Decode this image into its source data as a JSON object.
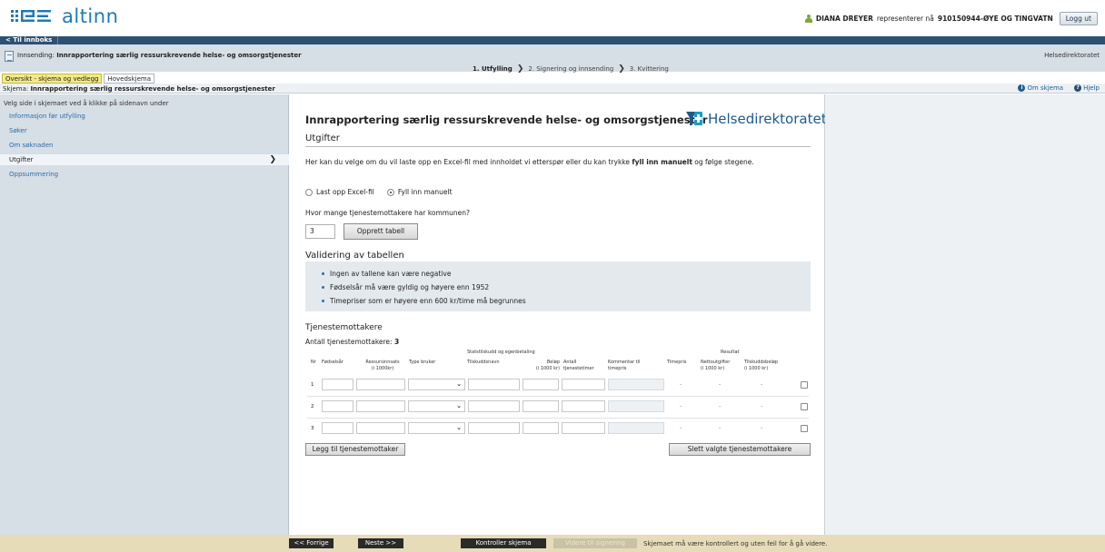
{
  "header": {
    "logo_text": "altinn",
    "user_name": "DIANA DREYER",
    "represents_text": "representerer nå",
    "org": "910150944-ØYE OG TINGVATN",
    "logout_label": "Logg ut"
  },
  "nav": {
    "back_label": "< Til innboks"
  },
  "subheader": {
    "doc_prefix": "Innsending: ",
    "doc_title": "Innrapportering særlig ressurskrevende helse- og omsorgstjenester",
    "agency": "Helsedirektoratet",
    "steps": [
      "1. Utfylling",
      "2. Signering og innsending",
      "3. Kvittering"
    ]
  },
  "tabs": [
    "Oversikt - skjema og vedlegg",
    "Hovedskjema"
  ],
  "schema_bar": {
    "prefix": "Skjema: ",
    "title": "Innrapportering særlig ressurskrevende helse- og omsorgstjenester",
    "about_label": "Om skjema",
    "help_label": "Hjelp"
  },
  "sidebar": {
    "hint": "Velg side i skjemaet ved å klikke på sidenavn under",
    "items": [
      "Informasjon før utfylling",
      "Søker",
      "Om søknaden",
      "Utgifter",
      "Oppsummering"
    ],
    "current_index": 3
  },
  "form": {
    "title": "Innrapportering særlig ressurskrevende helse- og omsorgstjenester",
    "brand": "Helsedirektoratet",
    "section": "Utgifter",
    "intro_part1": "Her kan du velge om du vil laste opp en Excel-fil med innholdet vi etterspør eller du kan trykke ",
    "intro_bold": "fyll inn manuelt",
    "intro_part2": " og følge stegene.",
    "radio_upload": "Last opp Excel-fil",
    "radio_manual": "Fyll inn manuelt",
    "radio_selected": "manual",
    "question": "Hvor mange tjenestemottakere har kommunen?",
    "count_value": "3",
    "create_table_label": "Opprett tabell",
    "validation_title": "Validering av tabellen",
    "validation_items": [
      "Ingen av tallene kan være negative",
      "Fødselsår må være gyldig og høyere enn 1952",
      "Timepriser som er høyere enn 600 kr/time må begrunnes"
    ],
    "recipients_title": "Tjenestemottakere",
    "recipients_count_label": "Antall tjenestemottakere: ",
    "recipients_count": "3"
  },
  "table": {
    "group_state": "Statstilskudd og egenbetaling",
    "group_result": "Resultat",
    "col_nr": "Nr",
    "col_birth": "Fødselsår",
    "col_resource_1": "Ressursinnsats",
    "col_resource_2": "(i 1000kr)",
    "col_type": "Type bruker",
    "col_grant": "Tilskuddsnavn",
    "col_amount_1": "Beløp",
    "col_amount_2": "(i 1000 kr)",
    "col_hours_1": "Antall",
    "col_hours_2": "tjenestetimer",
    "col_comment_1": "Kommentar til",
    "col_comment_2": "timepris",
    "col_hourly": "Timepris",
    "col_net_1": "Nettoutgifter",
    "col_net_2": "(i 1000 kr)",
    "col_grantamt_1": "Tilskuddsbeløp",
    "col_grantamt_2": "(i 1000 kr)",
    "rows": [
      {
        "nr": "1",
        "hourly": "-",
        "net": "-",
        "grant": "-"
      },
      {
        "nr": "2",
        "hourly": "-",
        "net": "-",
        "grant": "-"
      },
      {
        "nr": "3",
        "hourly": "-",
        "net": "-",
        "grant": "-"
      }
    ],
    "add_label": "Legg til tjenestemottaker",
    "delete_label": "Slett valgte tjenestemottakere"
  },
  "footer": {
    "prev_label": "<< Forrige",
    "next_label": "Neste >>",
    "check_label": "Kontroller skjema",
    "sign_label": "Videre til signering",
    "note": "Skjemaet må være kontrollert og uten feil for å gå videre."
  },
  "colors": {
    "brand_blue": "#1f7ab8",
    "nav_dark": "#2d5173",
    "sidebar_bg": "#d6dee6",
    "footer_bg": "#e6dcb8",
    "link_blue": "#2d6fa8"
  },
  "icons": [
    "altinn-logo-icon",
    "user-icon",
    "document-icon",
    "chevron-right-icon",
    "info-icon",
    "help-icon",
    "helsedirektoratet-logo-icon",
    "select-chevron-icon"
  ]
}
